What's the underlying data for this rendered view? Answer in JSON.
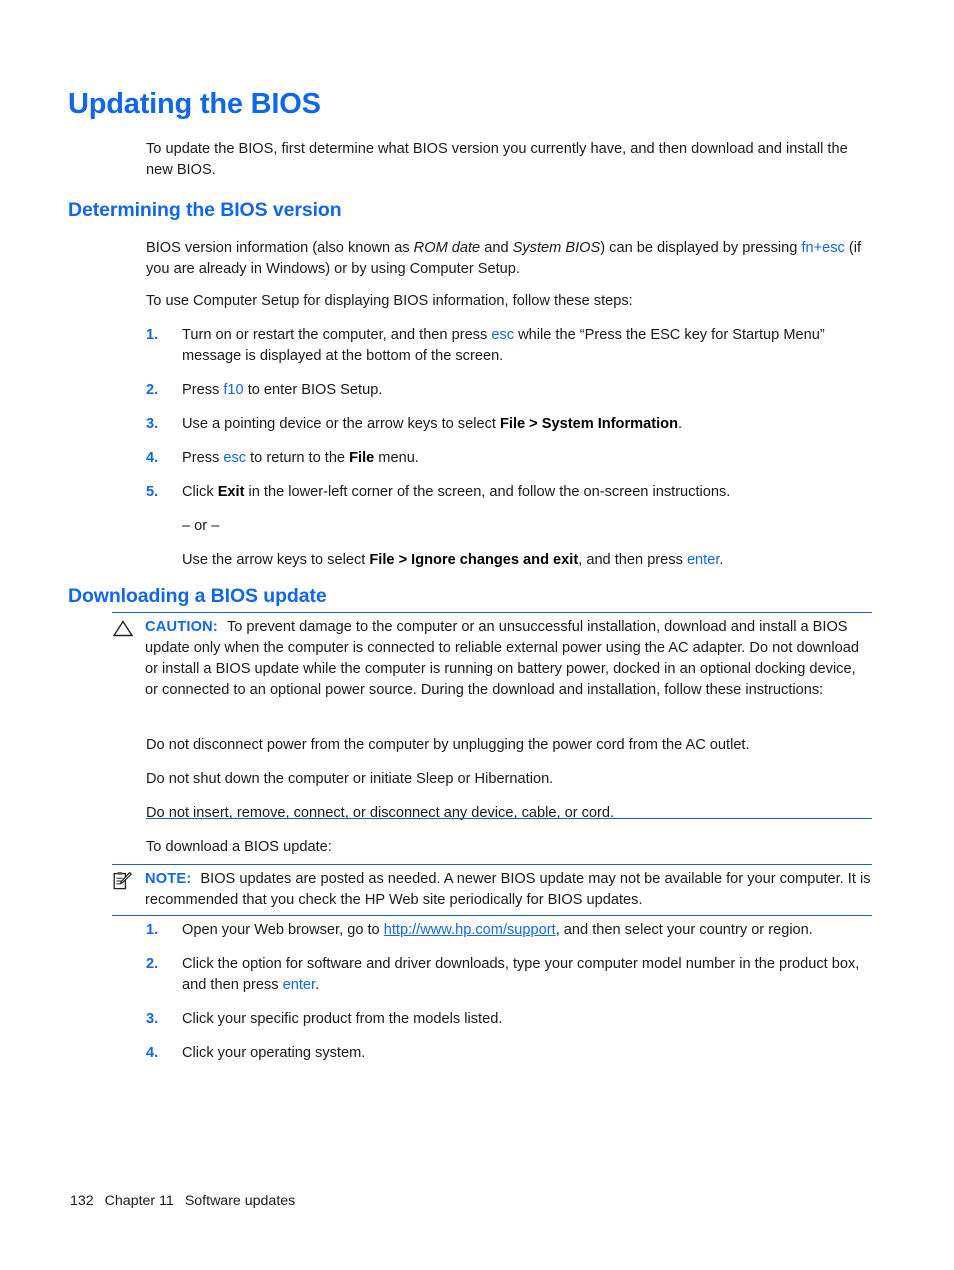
{
  "document": {
    "title": "Updating the BIOS",
    "intro": "To update the BIOS, first determine what BIOS version you currently have, and then download and install the new BIOS."
  },
  "section_determining": {
    "heading": "Determining the BIOS version",
    "para1_a": "BIOS version information (also known as ",
    "para1_italic1": "ROM date",
    "para1_b": " and ",
    "para1_italic2": "System BIOS",
    "para1_c": ") can be displayed by pressing ",
    "para1_key": "fn+esc",
    "para1_d": " (if you are already in Windows) or by using Computer Setup.",
    "para2": "To use Computer Setup for displaying BIOS information, follow these steps:",
    "steps": [
      {
        "number": "1.",
        "text_a": "Turn on or restart the computer, and then press ",
        "key": "esc",
        "text_b": " while the “Press the ESC key for Startup Menu” message is displayed at the bottom of the screen."
      },
      {
        "number": "2.",
        "text_a": "Press ",
        "key": "f10",
        "text_b": " to enter BIOS Setup."
      },
      {
        "number": "3.",
        "text_a": "Use a pointing device or the arrow keys to select ",
        "bold": "File > System Information",
        "text_b": "."
      },
      {
        "number": "4.",
        "text_a": "Press ",
        "key": "esc",
        "text_b": " to return to the ",
        "bold": "File",
        "text_c": " menu."
      },
      {
        "number": "5.",
        "text_a": "Click ",
        "bold": "Exit",
        "text_b": " in the lower-left corner of the screen, and follow the on-screen instructions.",
        "or_text": "– or –",
        "alt_a": "Use the arrow keys to select ",
        "alt_bold": "File > Ignore changes and exit",
        "alt_b": ", and then press ",
        "alt_key": "enter",
        "alt_c": "."
      }
    ]
  },
  "section_downloading": {
    "heading": "Downloading a BIOS update",
    "caution": {
      "icon": "warning-triangle-icon",
      "label": "CAUTION:",
      "text": "To prevent damage to the computer or an unsuccessful installation, download and install a BIOS update only when the computer is connected to reliable external power using the AC adapter. Do not download or install a BIOS update while the computer is running on battery power, docked in an optional docking device, or connected to an optional power source. During the download and installation, follow these instructions:",
      "bullets": [
        "Do not disconnect power from the computer by unplugging the power cord from the AC outlet.",
        "Do not shut down the computer or initiate Sleep or Hibernation.",
        "Do not insert, remove, connect, or disconnect any device, cable, or cord."
      ]
    },
    "download_intro": "To download a BIOS update:",
    "note": {
      "icon": "note-clipboard-icon",
      "label": "NOTE:",
      "text": "BIOS updates are posted as needed. A newer BIOS update may not be available for your computer. It is recommended that you check the HP Web site periodically for BIOS updates."
    },
    "steps": [
      {
        "number": "1.",
        "text_a": "Open your Web browser, go to ",
        "link": "http://www.hp.com/support",
        "text_b": ", and then select your country or region."
      },
      {
        "number": "2.",
        "text_a": "Click the option for software and driver downloads, type your computer model number in the product box, and then press ",
        "key": "enter",
        "text_b": "."
      },
      {
        "number": "3.",
        "text_a": "Click your specific product from the models listed."
      },
      {
        "number": "4.",
        "text_a": "Click your operating system."
      }
    ]
  },
  "footer": {
    "page_number": "132",
    "chapter": "Chapter 11",
    "chapter_title": "Software updates"
  },
  "colors": {
    "heading_blue": "#1068e8",
    "rule_blue": "#1c63c4",
    "body_black": "#1a1a1a"
  }
}
